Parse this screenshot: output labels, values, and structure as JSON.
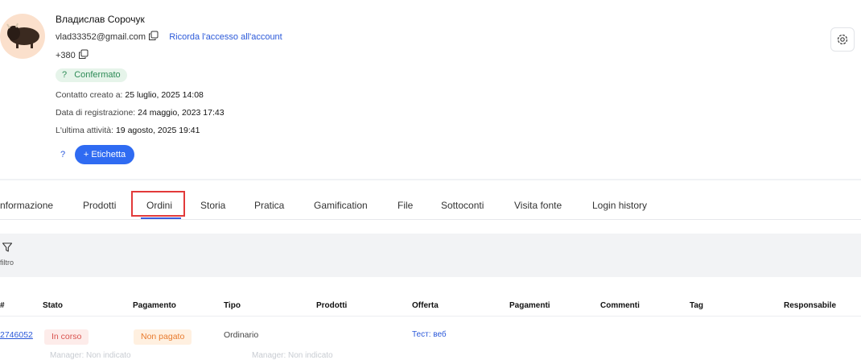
{
  "profile": {
    "name": "Владислав Сорочук",
    "email": "vlad33352@gmail.com",
    "remember_link": "Ricorda l'accesso all'account",
    "phone": "+380",
    "status_q": "?",
    "status": "Confermato",
    "created_label": "Contatto creato a:",
    "created_value": "25 luglio, 2025 14:08",
    "registered_label": "Data di registrazione:",
    "registered_value": "24 maggio, 2023 17:43",
    "activity_label": "L'ultima attività:",
    "activity_value": "19 agosto, 2025 19:41",
    "tag_help": "?",
    "add_tag_label": "+ Etichetta"
  },
  "tabs": [
    "nformazione",
    "Prodotti",
    "Ordini",
    "Storia",
    "Pratica",
    "Gamification",
    "File",
    "Sottoconti",
    "Visita fonte",
    "Login history"
  ],
  "filter": {
    "label": "filtro"
  },
  "table": {
    "headers": [
      "#",
      "Stato",
      "Pagamento",
      "Tipo",
      "Prodotti",
      "Offerta",
      "Pagamenti",
      "Commenti",
      "Tag",
      "Responsabile"
    ],
    "row": {
      "id": "2746052",
      "stato": "In corso",
      "pagamento": "Non pagato",
      "tipo": "Ordinario",
      "offerta": "Тест: веб"
    },
    "next_row_fragment": {
      "manager_1": "Manager: Non indicato",
      "manager_2": "Manager: Non indicato"
    }
  },
  "colors": {
    "accent": "#2f6bf2",
    "confirmed_bg": "#e6f4ea",
    "in_progress": "#d9534f",
    "unpaid": "#e87a2d",
    "highlight_box": "#e23a3a"
  }
}
